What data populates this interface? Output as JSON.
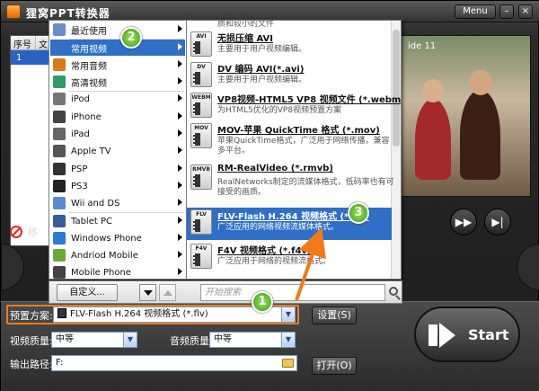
{
  "window": {
    "title": "狸窝PPT转换器",
    "menu_label": "Menu",
    "minimize_glyph": "–",
    "close_glyph": "×"
  },
  "file_table": {
    "columns": [
      "序号",
      "文"
    ],
    "rows": [
      {
        "no": "1",
        "name": ""
      }
    ],
    "remove_label": "移"
  },
  "preview": {
    "slide_label": "ide 11"
  },
  "category_menu": {
    "items": [
      {
        "label": "最近使用",
        "icon": "recent-icon",
        "has_submenu": true
      },
      {
        "label": "常用视频",
        "icon": "video-icon",
        "has_submenu": true,
        "selected": true
      },
      {
        "label": "常用音频",
        "icon": "audio-icon",
        "has_submenu": true
      },
      {
        "label": "高清视频",
        "icon": "hd-video-icon",
        "has_submenu": true
      },
      {
        "label": "iPod",
        "icon": "ipod-icon",
        "has_submenu": true
      },
      {
        "label": "iPhone",
        "icon": "iphone-icon",
        "has_submenu": true
      },
      {
        "label": "iPad",
        "icon": "ipad-icon",
        "has_submenu": true
      },
      {
        "label": "Apple TV",
        "icon": "apple-tv-icon",
        "has_submenu": true
      },
      {
        "label": "PSP",
        "icon": "psp-icon",
        "has_submenu": true
      },
      {
        "label": "PS3",
        "icon": "ps3-icon",
        "has_submenu": true
      },
      {
        "label": "Wii and DS",
        "icon": "wii-icon",
        "has_submenu": true
      },
      {
        "label": "Tablet PC",
        "icon": "tablet-icon",
        "has_submenu": true
      },
      {
        "label": "Windows Phone",
        "icon": "windows-phone-icon",
        "has_submenu": true
      },
      {
        "label": "Andriod Mobile",
        "icon": "android-icon",
        "has_submenu": true
      },
      {
        "label": "Mobile Phone",
        "icon": "mobile-phone-icon",
        "has_submenu": true
      }
    ]
  },
  "format_menu": {
    "items": [
      {
        "icon_text": "",
        "title": "",
        "desc": "质和较小的文件",
        "desc2": ""
      },
      {
        "icon_text": "AVI",
        "title": "无损压缩 AVI",
        "desc": "主要用于用户视频编辑。",
        "desc2": ""
      },
      {
        "icon_text": "DV",
        "title": "DV 编码 AVI(*.avi)",
        "desc": "主要用于用户视频编辑。",
        "desc2": ""
      },
      {
        "icon_text": "WEBM",
        "title": "VP8视频-HTML5 VP8 视频文件 (*.webm)",
        "desc": "为HTML5优化的VP8视频预置方案",
        "desc2": ""
      },
      {
        "icon_text": "MOV",
        "title": "MOV-苹果 QuickTime 格式 (*.mov)",
        "desc": "苹果QuickTime格式，广泛用于网络传播，兼容",
        "desc2": "多平台。"
      },
      {
        "icon_text": "RMVB",
        "title": "RM-RealVideo (*.rmvb)",
        "desc": "RealNetworks制定的流媒体格式，低码率也有可",
        "desc2": "接受的画质。"
      },
      {
        "icon_text": "FLV",
        "title": "FLV-Flash H.264 视频格式 (*.flv)",
        "desc": "广泛应用的网络视频流媒体格式。",
        "desc2": "",
        "selected": true
      },
      {
        "icon_text": "F4V",
        "title": "F4V 视频格式 (*.f4v)",
        "desc": "广泛应用于网络的视频流格式。",
        "desc2": ""
      }
    ]
  },
  "popup_bottom": {
    "custom_label": "自定义...",
    "search_placeholder": "开始搜索"
  },
  "settings": {
    "preset_label": "预置方案:",
    "preset_value": "FLV-Flash H.264 视频格式 (*.flv)",
    "set_button": "设置(S)",
    "video_quality_label": "视频质量:",
    "video_quality_value": "中等",
    "audio_quality_label": "音频质量:",
    "audio_quality_value": "中等",
    "output_label": "输出路径:",
    "output_value": "F:",
    "open_button": "打开(O)",
    "start_label": "Start"
  },
  "annotations": {
    "badge_1": "1",
    "badge_2": "2",
    "badge_3": "3"
  },
  "colors": {
    "accent_blue": "#2f6fc6",
    "highlight_orange": "#f07a1a",
    "badge_green": "#3f9a1a"
  }
}
